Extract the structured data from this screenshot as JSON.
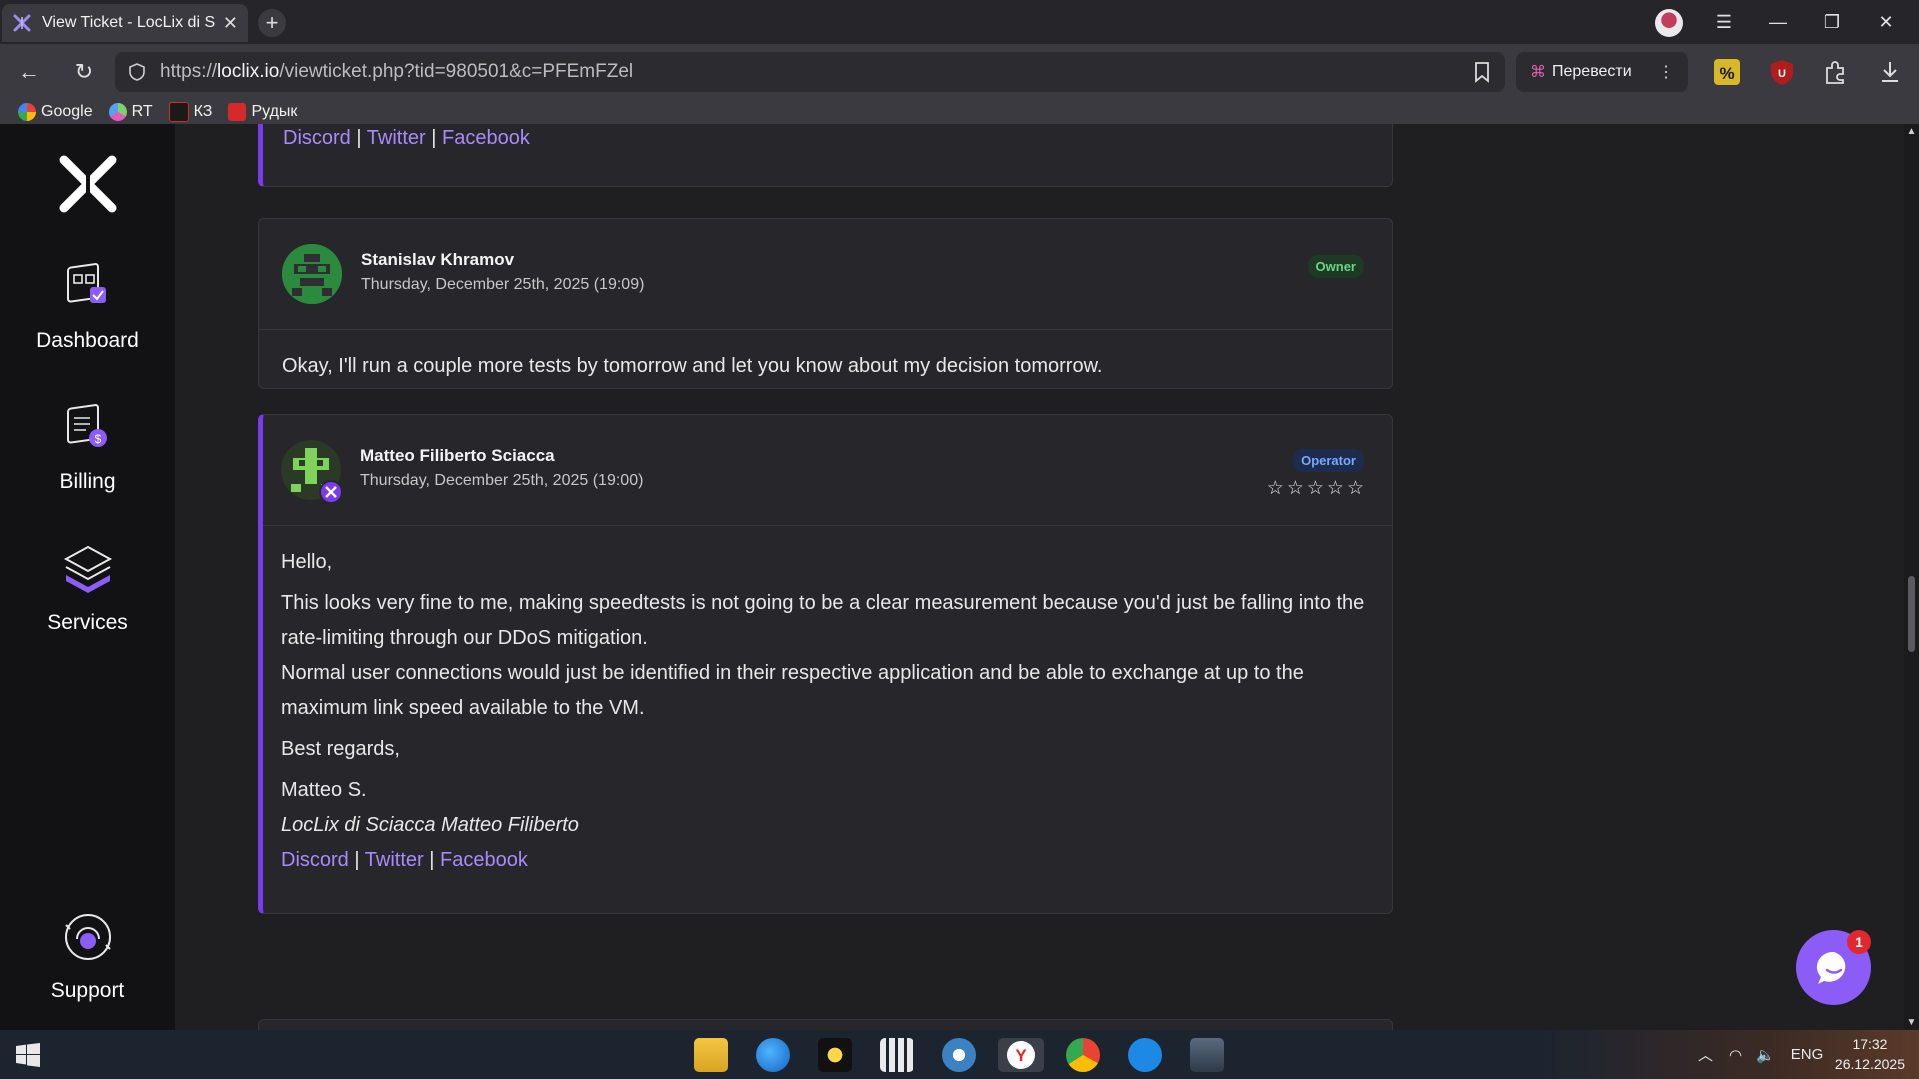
{
  "browser": {
    "tab_title": "View Ticket - LocLix di S",
    "url_prefix": "https://",
    "url_domain": "loclix.io",
    "url_path": "/viewticket.php?tid=980501&c=PFEmFZel",
    "translate_label": "Перевести",
    "bookmarks": [
      {
        "label": "Google",
        "color": "#4285f4"
      },
      {
        "label": "RT",
        "color": "#7bd16b"
      },
      {
        "label": "КЗ",
        "color": "#d12a2a"
      },
      {
        "label": "Рудык",
        "color": "#d62a2a"
      }
    ]
  },
  "sidebar": {
    "items": [
      {
        "label": "Dashboard"
      },
      {
        "label": "Billing"
      },
      {
        "label": "Services"
      },
      {
        "label": "Support"
      }
    ]
  },
  "signature_top": {
    "links": [
      "Discord",
      "Twitter",
      "Facebook"
    ],
    "separator": "|"
  },
  "messages": [
    {
      "author": "Stanislav Khramov",
      "date": "Thursday, December 25th, 2025 (19:09)",
      "badge": "Owner",
      "body": "Okay, I'll run a couple more tests by tomorrow and let you know about my decision tomorrow."
    },
    {
      "author": "Matteo Filiberto Sciacca",
      "date": "Thursday, December 25th, 2025 (19:00)",
      "badge": "Operator",
      "rating": 0,
      "rating_max": 5,
      "greeting": "Hello,",
      "para1": "This looks very fine to me, making speedtests is not going to be a clear measurement because you'd just be falling into the rate-limiting through our DDoS mitigation.",
      "para2": "Normal user connections would just be identified in their respective application and be able to exchange at up to the maximum link speed available to the VM.",
      "closing": "Best regards,",
      "sig_name": "Matteo S.",
      "sig_company": "LocLix di Sciacca Matteo Filiberto",
      "links": [
        "Discord",
        "Twitter",
        "Facebook"
      ]
    }
  ],
  "chat_widget": {
    "unread": "1"
  },
  "taskbar": {
    "language": "ENG",
    "time": "17:32",
    "date": "26.12.2025"
  },
  "colors": {
    "accent": "#7c3aed",
    "link": "#a78bfa",
    "owner_badge": "#6ad38a",
    "operator_badge": "#7aa7ff"
  }
}
